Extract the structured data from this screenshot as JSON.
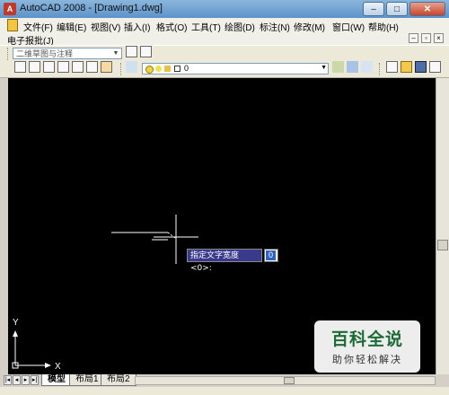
{
  "window": {
    "title": "AutoCAD 2008 - [Drawing1.dwg]",
    "app_icon_glyph": "A",
    "minimize_glyph": "–",
    "maximize_glyph": "□",
    "close_glyph": "✕"
  },
  "menubar": {
    "items": [
      "文件(F)",
      "编辑(E)",
      "视图(V)",
      "插入(I)",
      "格式(O)",
      "工具(T)",
      "绘图(D)",
      "标注(N)",
      "修改(M)",
      "窗口(W)",
      "帮助(H)"
    ]
  },
  "second_menu": {
    "label": "电子报批(J)",
    "mdi_minimize": "–",
    "mdi_restore": "▫",
    "mdi_close": "×"
  },
  "toolbar1": {
    "workspace_value": "二维草图与注释",
    "dropdown_arrow": "▼"
  },
  "toolbar2": {
    "layer_value": "0",
    "dropdown_arrow": "▼"
  },
  "canvas": {
    "background": "#000000",
    "prompt_label": "指定文字宽度 <0>:",
    "prompt_input_value": "0",
    "ucs_y_label": "Y",
    "ucs_x_label": "X"
  },
  "layout_tabs": {
    "nav": [
      "|◂",
      "◂",
      "▸",
      "▸|"
    ],
    "tabs": [
      "模型",
      "布局1",
      "布局2"
    ],
    "active_index": 0
  },
  "watermark": {
    "title": "百科全说",
    "subtitle": "助你轻松解决"
  },
  "colors": {
    "titlebar": "#6fa3d6",
    "canvas": "#000000",
    "prompt_bg": "#3a3a8c",
    "watermark_green": "#1c6b37"
  }
}
